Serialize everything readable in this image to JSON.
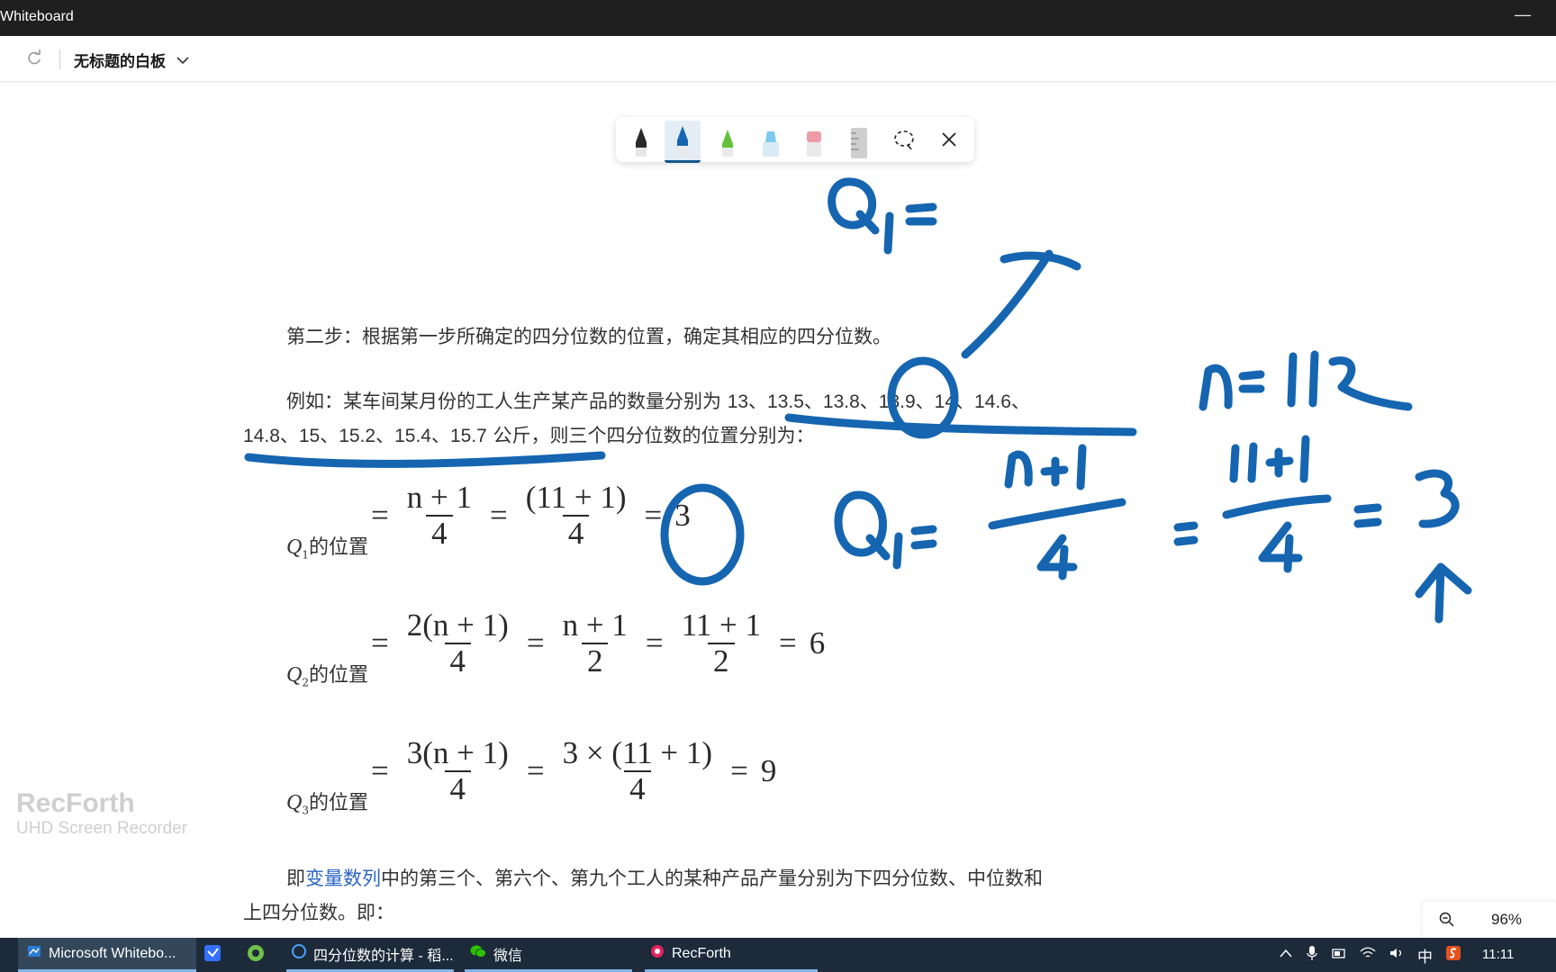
{
  "window": {
    "title": "Whiteboard"
  },
  "appbar": {
    "board_title": "无标题的白板"
  },
  "ink_toolbar": {
    "tools": [
      "black-pen",
      "blue-pen",
      "green-pen",
      "highlighter",
      "eraser",
      "ruler",
      "lasso-select",
      "close"
    ],
    "selected": "blue-pen"
  },
  "document": {
    "step2": "第二步：根据第一步所确定的四分位数的位置，确定其相应的四分位数。",
    "example_prefix": "例如：某车间某月份的工人生产某产品的数量分别为 ",
    "example_numbers_line1": "13、13.5、13.8、13.9、14、14.6、",
    "example_numbers_line2": "14.8、15、15.2、15.4、15.7",
    "example_unit": " 公斤，",
    "example_suffix": "则三个四分位数的位置分别为：",
    "q1": {
      "sym": "Q",
      "sub": "1",
      "label": "的位置",
      "f1_num": "n + 1",
      "f1_den": "4",
      "f2_num": "(11 + 1)",
      "f2_den": "4",
      "result": "3"
    },
    "q2": {
      "sym": "Q",
      "sub": "2",
      "label": "的位置",
      "f1_num": "2(n + 1)",
      "f1_den": "4",
      "f2_num": "n + 1",
      "f2_den": "2",
      "f3_num": "11 + 1",
      "f3_den": "2",
      "result": "6"
    },
    "q3": {
      "sym": "Q",
      "sub": "3",
      "label": "的位置",
      "f1_num": "3(n + 1)",
      "f1_den": "4",
      "f2_num": "3 × (11 + 1)",
      "f2_den": "4",
      "result": "9"
    },
    "conclusion_prefix": "即",
    "conclusion_link": "变量数列",
    "conclusion_mid": "中的第三个、第六个、第九个工人的某种产品产量分别为下四分位数、中位数和",
    "conclusion_line2": "上四分位数。即："
  },
  "ink_annotations": [
    "Q₁=",
    "n=11",
    "Q₁= (n+1)/4 = (11+1)/4 = 3"
  ],
  "watermark": {
    "title": "RecForth",
    "subtitle": "UHD Screen Recorder"
  },
  "zoom": {
    "value": "96%"
  },
  "taskbar": {
    "apps": [
      {
        "label": "Microsoft Whitebo...",
        "icon": "whiteboard-icon",
        "state": "active"
      },
      {
        "label": "",
        "icon": "feishu-icon",
        "state": "idle"
      },
      {
        "label": "",
        "icon": "chrome-icon",
        "state": "idle"
      },
      {
        "label": "四分位数的计算 - 稻...",
        "icon": "browser-icon",
        "state": "running"
      },
      {
        "label": "微信",
        "icon": "wechat-icon",
        "state": "running"
      },
      {
        "label": "RecForth",
        "icon": "record-icon",
        "state": "running"
      }
    ],
    "ime": "中",
    "clock": "11:11"
  },
  "colors": {
    "ink_blue": "#1565b0",
    "titlebar": "#1f1f1f",
    "taskbar": "#1c2a3a",
    "link": "#2b65c4"
  }
}
